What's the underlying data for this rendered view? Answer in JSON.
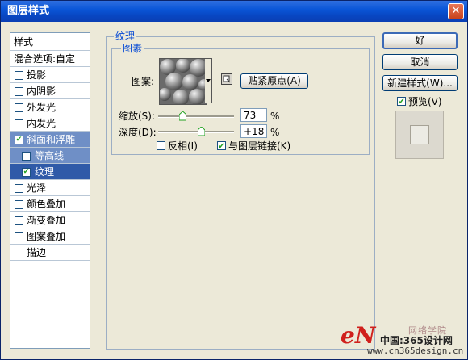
{
  "window": {
    "title": "图层样式",
    "close_glyph": "✕"
  },
  "left_panel": {
    "header": "样式",
    "blend_options": "混合选项:自定",
    "items": [
      {
        "label": "投影",
        "checked": false
      },
      {
        "label": "内阴影",
        "checked": false
      },
      {
        "label": "外发光",
        "checked": false
      },
      {
        "label": "内发光",
        "checked": false
      },
      {
        "label": "斜面和浮雕",
        "checked": true
      },
      {
        "label": "等高线",
        "checked": false
      },
      {
        "label": "纹理",
        "checked": true
      },
      {
        "label": "光泽",
        "checked": false
      },
      {
        "label": "颜色叠加",
        "checked": false
      },
      {
        "label": "渐变叠加",
        "checked": false
      },
      {
        "label": "图案叠加",
        "checked": false
      },
      {
        "label": "描边",
        "checked": false
      }
    ]
  },
  "texture": {
    "group_title": "纹理",
    "sub_group_title": "图素",
    "pattern_label": "图案:",
    "snap_origin_button": "贴紧原点(A)",
    "scale_label": "缩放(S):",
    "scale_value": "73",
    "scale_unit": "%",
    "depth_label": "深度(D):",
    "depth_value": "+18",
    "depth_unit": "%",
    "invert_label": "反相(I)",
    "invert_checked": false,
    "link_label": "与图层链接(K)",
    "link_checked": true
  },
  "buttons": {
    "ok": "好",
    "cancel": "取消",
    "new_style": "新建样式(W)...",
    "preview_label": "预览(V)",
    "preview_checked": true
  },
  "watermark": {
    "site_cn": "中国:365设计网",
    "site_url": "www.cn365design.cn",
    "brand_letters": "eN",
    "brand_tag": "网络学院"
  },
  "colors": {
    "title_blue": "#0a56d8",
    "selected_row": "#2f5aa8",
    "selected_parent": "#6f8fc6",
    "group_label": "#0046d5"
  }
}
